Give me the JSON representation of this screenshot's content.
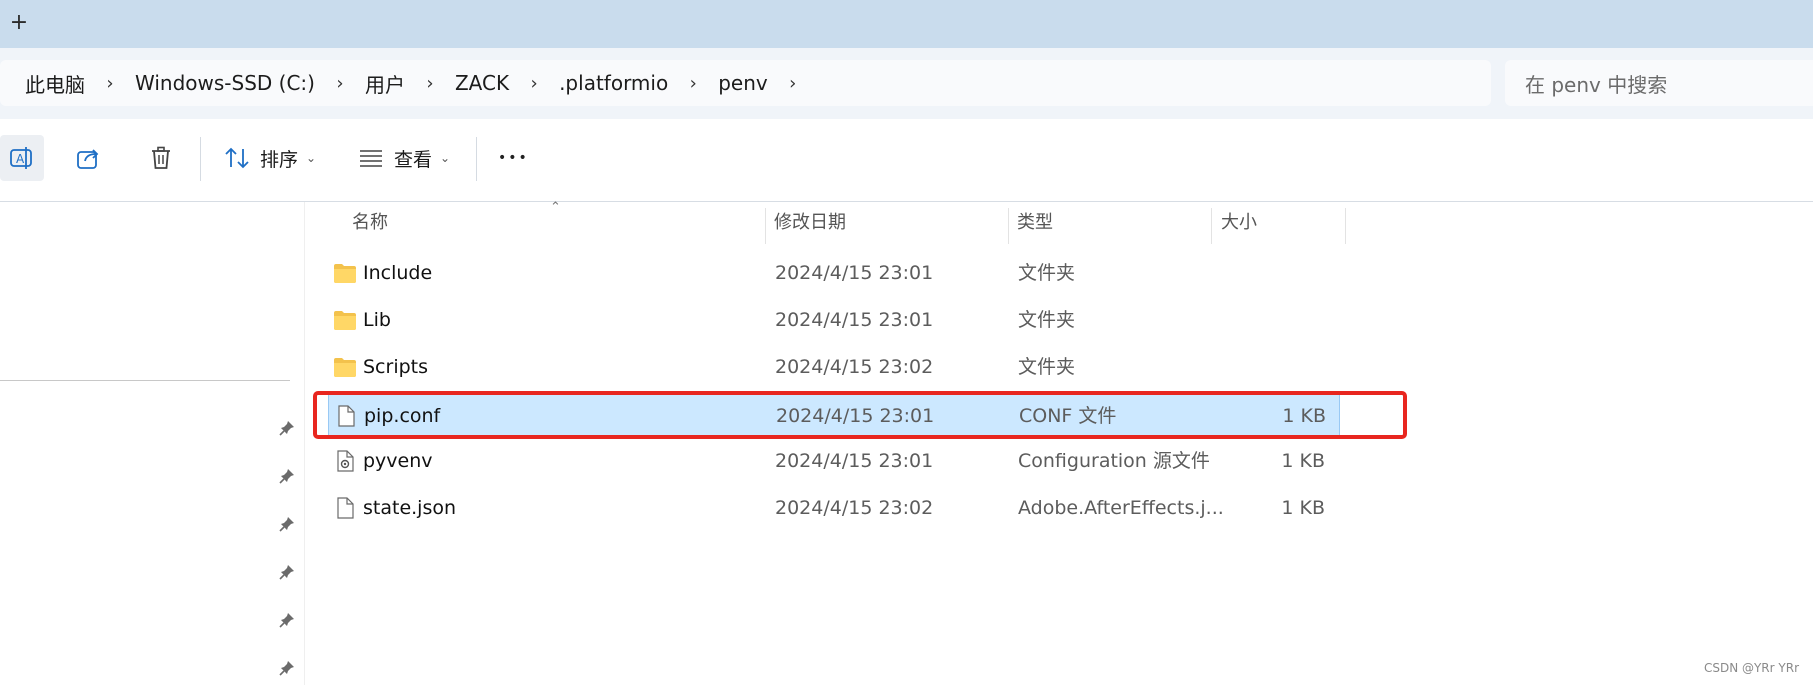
{
  "tabstrip": {
    "new_tab_label": "+"
  },
  "breadcrumb": {
    "items": [
      "此电脑",
      "Windows-SSD (C:)",
      "用户",
      "ZACK",
      ".platformio",
      "penv"
    ],
    "separator": "›"
  },
  "search": {
    "placeholder": "在 penv 中搜索"
  },
  "toolbar": {
    "sort_label": "排序",
    "view_label": "查看",
    "more_label": "•••"
  },
  "columns": {
    "name": "名称",
    "date": "修改日期",
    "type": "类型",
    "size": "大小"
  },
  "files": [
    {
      "name": "Include",
      "date": "2024/4/15 23:01",
      "type": "文件夹",
      "size": "",
      "icon": "folder-icon"
    },
    {
      "name": "Lib",
      "date": "2024/4/15 23:01",
      "type": "文件夹",
      "size": "",
      "icon": "folder-icon"
    },
    {
      "name": "Scripts",
      "date": "2024/4/15 23:02",
      "type": "文件夹",
      "size": "",
      "icon": "folder-icon"
    },
    {
      "name": "pip.conf",
      "date": "2024/4/15 23:01",
      "type": "CONF 文件",
      "size": "1 KB",
      "icon": "file-icon",
      "selected": true
    },
    {
      "name": "pyvenv",
      "date": "2024/4/15 23:01",
      "type": "Configuration 源文件",
      "size": "1 KB",
      "icon": "config-file-icon"
    },
    {
      "name": "state.json",
      "date": "2024/4/15 23:02",
      "type": "Adobe.AfterEffects.j...",
      "size": "1 KB",
      "icon": "file-icon"
    }
  ],
  "colors": {
    "selection": "#cce8ff",
    "highlight_box": "#e8261f",
    "tabstrip": "#c9dced"
  },
  "watermark": "CSDN @YRr YRr"
}
